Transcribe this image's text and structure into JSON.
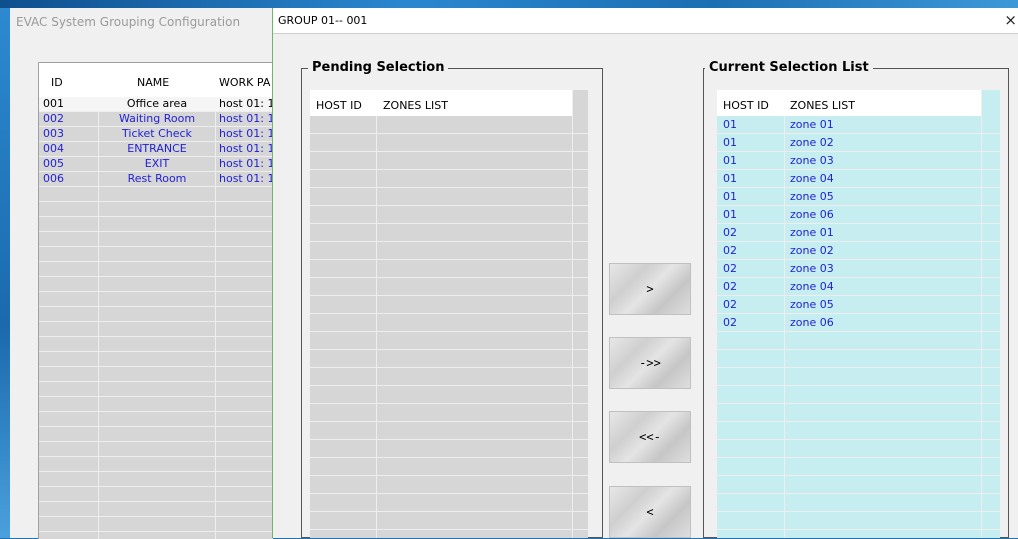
{
  "back_window": {
    "title": "EVAC System Grouping Configuration",
    "columns": [
      "ID",
      "NAME",
      "WORK PA"
    ],
    "rows": [
      {
        "id": "001",
        "name": "Office area",
        "work": "host 01: 1"
      },
      {
        "id": "002",
        "name": "Waiting Room",
        "work": "host 01: 1"
      },
      {
        "id": "003",
        "name": "Ticket Check",
        "work": "host 01: 1"
      },
      {
        "id": "004",
        "name": "ENTRANCE",
        "work": "host 01: 1"
      },
      {
        "id": "005",
        "name": "EXIT",
        "work": "host 01: 1"
      },
      {
        "id": "006",
        "name": "Rest Room",
        "work": "host 01: 1"
      }
    ]
  },
  "dialog": {
    "title": "GROUP 01-- 001",
    "close_label": "×",
    "pending": {
      "legend": "Pending Selection",
      "col_host": "HOST ID",
      "col_zones": "ZONES LIST",
      "rows": []
    },
    "current": {
      "legend": "Current Selection List",
      "col_host": "HOST ID",
      "col_zones": "ZONES LIST",
      "rows": [
        {
          "host": "01",
          "zone": "zone 01"
        },
        {
          "host": "01",
          "zone": "zone 02"
        },
        {
          "host": "01",
          "zone": "zone 03"
        },
        {
          "host": "01",
          "zone": "zone 04"
        },
        {
          "host": "01",
          "zone": "zone 05"
        },
        {
          "host": "01",
          "zone": "zone 06"
        },
        {
          "host": "02",
          "zone": "zone 01"
        },
        {
          "host": "02",
          "zone": "zone 02"
        },
        {
          "host": "02",
          "zone": "zone 03"
        },
        {
          "host": "02",
          "zone": "zone 04"
        },
        {
          "host": "02",
          "zone": "zone 05"
        },
        {
          "host": "02",
          "zone": "zone 06"
        }
      ]
    },
    "buttons": {
      "add_one": ">",
      "add_all": "->>",
      "remove_all": "<<-",
      "remove_one": "<"
    }
  },
  "colors": {
    "text_blue": "#1f1fd6",
    "selected_row": "#f5f5f5",
    "current_bg": "#c6eef0",
    "pending_bg": "#d6d6d6"
  }
}
